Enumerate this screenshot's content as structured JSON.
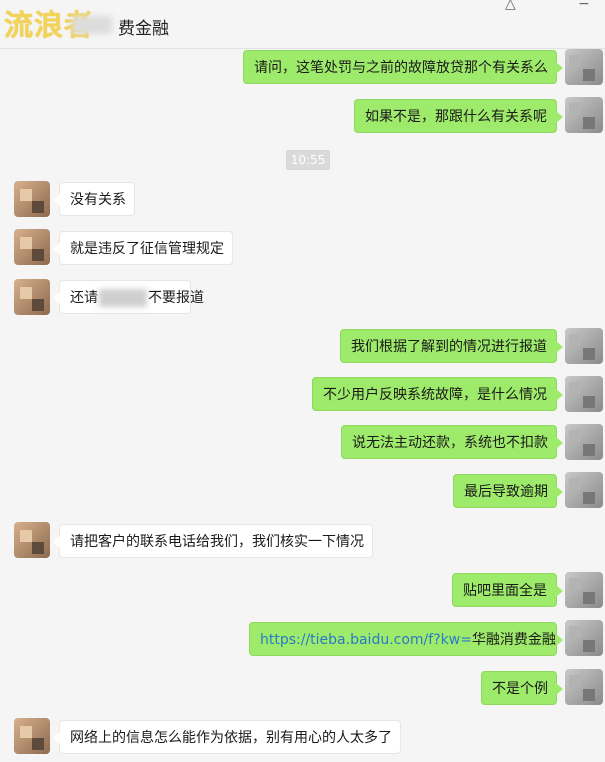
{
  "header": {
    "watermark": "流浪者",
    "title": "费金融"
  },
  "time_divider": "10:55",
  "messages": [
    {
      "side": "right",
      "text": "请问，这笔处罚与之前的故障放贷那个有关系么"
    },
    {
      "side": "right",
      "text": "如果不是，那跟什么有关系呢"
    },
    {
      "side": "left",
      "text": "没有关系"
    },
    {
      "side": "left",
      "text": "就是违反了征信管理规定"
    },
    {
      "side": "left",
      "text_before": "还请",
      "text_after": "不要报道"
    },
    {
      "side": "right",
      "text": "我们根据了解到的情况进行报道"
    },
    {
      "side": "right",
      "text": "不少用户反映系统故障，是什么情况"
    },
    {
      "side": "right",
      "text": "说无法主动还款，系统也不扣款"
    },
    {
      "side": "right",
      "text": "最后导致逾期"
    },
    {
      "side": "left",
      "text": "请把客户的联系电话给我们，我们核实一下情况"
    },
    {
      "side": "right",
      "text": "贴吧里面全是"
    },
    {
      "side": "right",
      "link_text": "https://tieba.baidu.com/f?kw=",
      "text": "华融消费金融"
    },
    {
      "side": "right",
      "text": "不是个例"
    },
    {
      "side": "left",
      "text": "网络上的信息怎么能作为依据，别有用心的人太多了"
    }
  ]
}
